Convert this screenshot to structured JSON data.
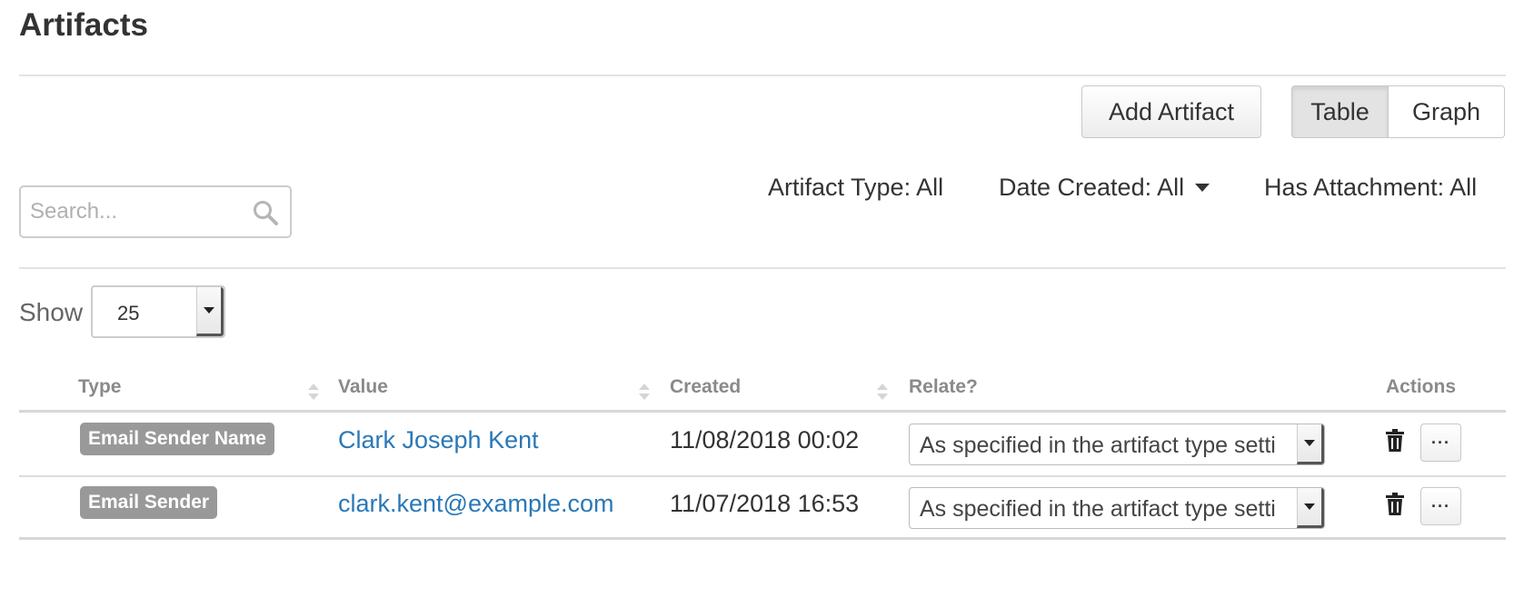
{
  "page": {
    "title": "Artifacts"
  },
  "toolbar": {
    "add_artifact_label": "Add Artifact",
    "view_toggle": {
      "table_label": "Table",
      "graph_label": "Graph",
      "active": "Table"
    }
  },
  "search": {
    "placeholder": "Search...",
    "value": ""
  },
  "filters": {
    "artifact_type": "Artifact Type: All",
    "date_created": "Date Created: All",
    "has_attachment": "Has Attachment: All"
  },
  "pagination": {
    "show_label": "Show",
    "page_size": "25"
  },
  "table": {
    "columns": {
      "type": "Type",
      "value": "Value",
      "created": "Created",
      "relate": "Relate?",
      "actions": "Actions"
    },
    "rows": [
      {
        "type": "Email Sender Name",
        "value": "Clark Joseph Kent",
        "created": "11/08/2018 00:02",
        "relate": "As specified in the artifact type setti",
        "more_label": "···"
      },
      {
        "type": "Email Sender",
        "value": "clark.kent@example.com",
        "created": "11/07/2018 16:53",
        "relate": "As specified in the artifact type setti",
        "more_label": "···"
      }
    ]
  },
  "colors": {
    "link": "#2a78b7",
    "badge": "#999999",
    "header_text": "#8a8a8a"
  }
}
